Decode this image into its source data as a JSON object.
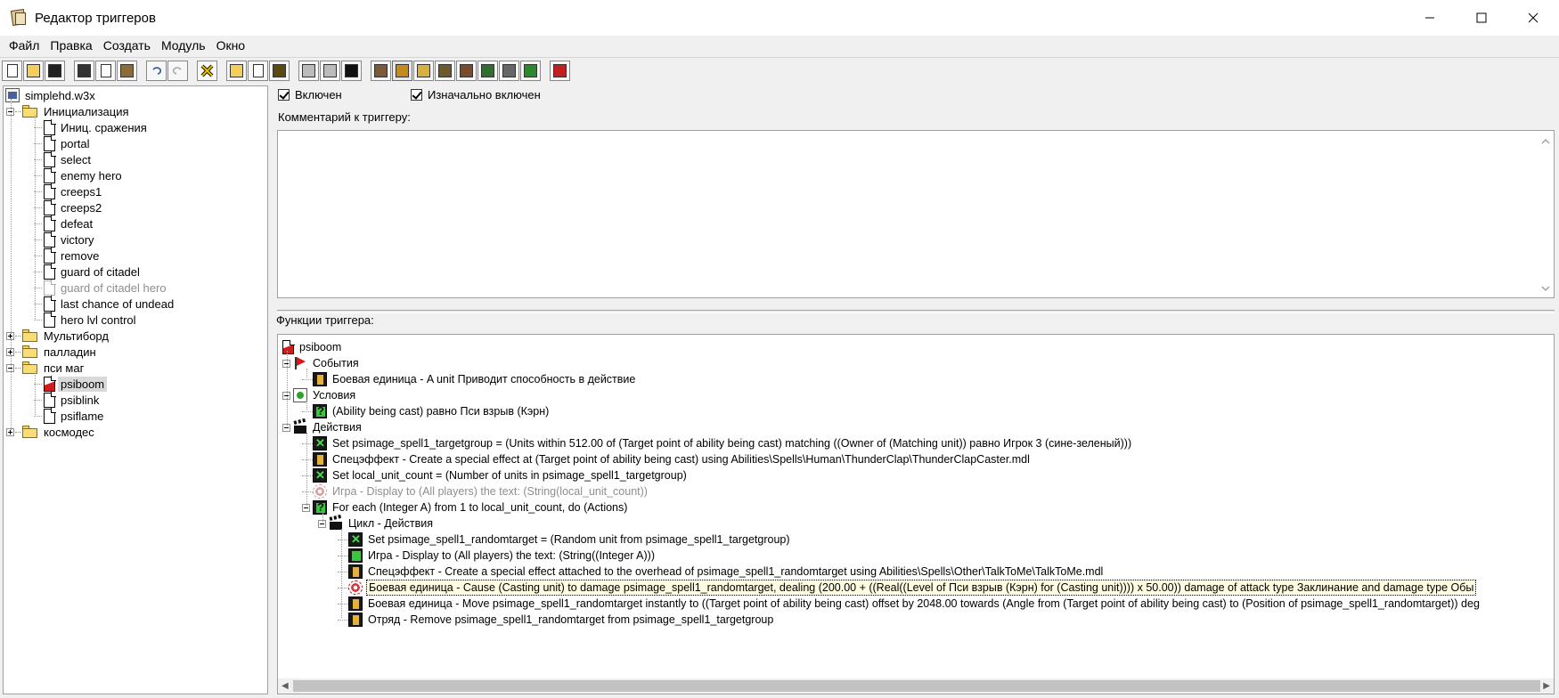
{
  "window": {
    "title": "Редактор триггеров"
  },
  "menu": [
    "Файл",
    "Правка",
    "Создать",
    "Модуль",
    "Окно"
  ],
  "toolbar_icons": [
    "new-doc-icon",
    "open-folder-icon",
    "save-disk-icon",
    "sep",
    "cut-scissors-icon",
    "copy-icon",
    "paste-icon",
    "sep",
    "undo-icon",
    "redo-icon",
    "sep",
    "delete-x-icon",
    "sep",
    "new-category-icon",
    "new-trigger-icon",
    "new-variable-icon",
    "sep",
    "new-event-icon",
    "new-condition-icon",
    "new-action-icon",
    "sep",
    "terrain-icon",
    "object-icon",
    "sound-icon",
    "ai-icon",
    "camera-icon",
    "region-icon",
    "import-icon",
    "new-map-icon",
    "sep",
    "test-map-icon"
  ],
  "tree": {
    "root": "simplehd.w3x",
    "items": [
      {
        "label": "Инициализация",
        "type": "folder",
        "expanded": true,
        "children": [
          {
            "label": "Иниц. сражения",
            "type": "trigger"
          },
          {
            "label": "portal",
            "type": "trigger"
          },
          {
            "label": "select",
            "type": "trigger"
          },
          {
            "label": "enemy hero",
            "type": "trigger"
          },
          {
            "label": "creeps1",
            "type": "trigger"
          },
          {
            "label": "creeps2",
            "type": "trigger"
          },
          {
            "label": "defeat",
            "type": "trigger"
          },
          {
            "label": "victory",
            "type": "trigger"
          },
          {
            "label": "remove",
            "type": "trigger"
          },
          {
            "label": "guard of citadel",
            "type": "trigger"
          },
          {
            "label": "guard of citadel hero",
            "type": "trigger",
            "disabled": true
          },
          {
            "label": "last chance of undead",
            "type": "trigger"
          },
          {
            "label": "hero lvl control",
            "type": "trigger"
          }
        ]
      },
      {
        "label": "Мультиборд",
        "type": "folder",
        "expanded": false
      },
      {
        "label": "палладин",
        "type": "folder",
        "expanded": false
      },
      {
        "label": "пси маг",
        "type": "folder",
        "expanded": true,
        "children": [
          {
            "label": "psiboom",
            "type": "trigger",
            "selected": true
          },
          {
            "label": "psiblink",
            "type": "trigger"
          },
          {
            "label": "psiflame",
            "type": "trigger"
          }
        ]
      },
      {
        "label": "космодес",
        "type": "folder",
        "expanded": false
      }
    ]
  },
  "trigger": {
    "enabled_label": "Включен",
    "initially_enabled_label": "Изначально включен",
    "comment_label": "Комментарий к триггеру:",
    "comment_value": "",
    "functions_label": "Функции триггера:"
  },
  "functions": [
    {
      "text": "psiboom",
      "icon": "trigger",
      "level": 0
    },
    {
      "text": "События",
      "icon": "events",
      "level": 1,
      "expander": true
    },
    {
      "text": "Боевая единица - A unit Приводит способность в действие",
      "icon": "unit",
      "level": 2
    },
    {
      "text": "Условия",
      "icon": "conditions",
      "level": 1,
      "expander": true
    },
    {
      "text": "(Ability being cast) равно Пси взрыв (Кэрн)",
      "icon": "question",
      "level": 2
    },
    {
      "text": "Действия",
      "icon": "actions",
      "level": 1,
      "expander": true
    },
    {
      "text": "Set psimage_spell1_targetgroup = (Units within 512.00 of (Target point of ability being cast) matching ((Owner of (Matching unit)) равно Игрок 3 (сине-зеленый)))",
      "icon": "set",
      "level": 2
    },
    {
      "text": "Спецэффект - Create a special effect at (Target point of ability being cast) using Abilities\\Spells\\Human\\ThunderClap\\ThunderClapCaster.mdl",
      "icon": "effect",
      "level": 2
    },
    {
      "text": "Set local_unit_count = (Number of units in psimage_spell1_targetgroup)",
      "icon": "set",
      "level": 2
    },
    {
      "text": "Игра - Display to (All players) the text: (String(local_unit_count))",
      "icon": "game-disabled",
      "level": 2,
      "disabled": true
    },
    {
      "text": "For each (Integer A) from 1 to local_unit_count, do (Actions)",
      "icon": "question",
      "level": 2,
      "expander": true
    },
    {
      "text": "Цикл - Действия",
      "icon": "actions",
      "level": 3,
      "expander": true
    },
    {
      "text": "Set psimage_spell1_randomtarget = (Random unit from psimage_spell1_targetgroup)",
      "icon": "set",
      "level": 4
    },
    {
      "text": "Игра - Display to (All players) the text: (String((Integer A)))",
      "icon": "game",
      "level": 4
    },
    {
      "text": "Спецэффект - Create a special effect attached to the overhead of psimage_spell1_randomtarget using Abilities\\Spells\\Other\\TalkToMe\\TalkToMe.mdl",
      "icon": "effect",
      "level": 4
    },
    {
      "text": "Боевая единица - Cause (Casting unit) to damage psimage_spell1_randomtarget, dealing (200.00 + ((Real((Level of Пси взрыв (Кэрн) for (Casting unit)))) x 50.00)) damage of attack type Заклинание and damage type Обы",
      "icon": "gear",
      "level": 4,
      "selected": true
    },
    {
      "text": "Боевая единица - Move psimage_spell1_randomtarget instantly to ((Target point of ability being cast) offset by 2048.00 towards (Angle from (Target point of ability being cast) to (Position of psimage_spell1_randomtarget)) deg",
      "icon": "unit",
      "level": 4
    },
    {
      "text": "Отряд - Remove psimage_spell1_randomtarget from psimage_spell1_targetgroup",
      "icon": "unit",
      "level": 4
    }
  ]
}
